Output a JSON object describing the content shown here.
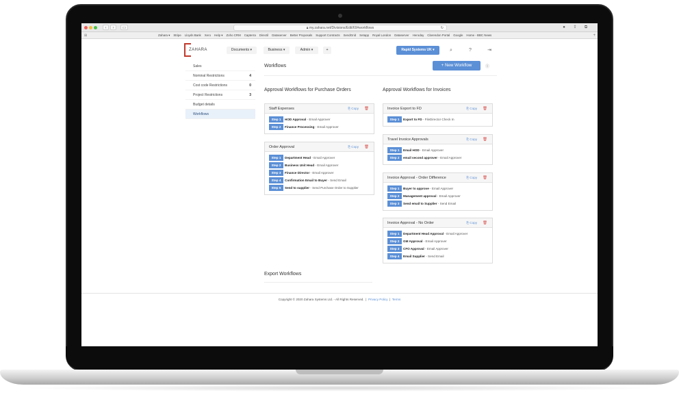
{
  "browser": {
    "url": "my.zahara.net/Divisions/Edit/69#workflows",
    "bookmarks": [
      "Zahara ▾",
      "Stripe",
      "Lloyds Bank",
      "Xero",
      "Help ▾",
      "Zoho CRM",
      "Capterra",
      "Directil",
      "Dataserver",
      "Better Proposals",
      "Support Contracts",
      "SendGrid",
      "Setapp",
      "Royal London",
      "Dataserver",
      "Heroday",
      "Clarendon Portal",
      "Google",
      "Home - BBC News"
    ]
  },
  "header": {
    "logo_text": "ZAHARA",
    "nav": [
      "Documents ▾",
      "Business ▾",
      "Admin ▾",
      "+"
    ],
    "company_button": "Rapid Systems UK ▾"
  },
  "sidebar": {
    "items": [
      {
        "label": "Sales",
        "count": ""
      },
      {
        "label": "Nominal Restrictions",
        "count": "4"
      },
      {
        "label": "Cost code Restrictions",
        "count": "0"
      },
      {
        "label": "Project Restrictions",
        "count": "3"
      },
      {
        "label": "Budget details",
        "count": ""
      },
      {
        "label": "Workflows",
        "count": ""
      }
    ]
  },
  "main": {
    "title": "Workflows",
    "new_button": "+ New Workflow",
    "po_section_title": "Approval Workflows for Purchase Orders",
    "inv_section_title": "Approval Workflows for Invoices",
    "export_section_title": "Export Workflows",
    "copy_label": "Copy",
    "po_workflows": [
      {
        "title": "Staff Expenses",
        "steps": [
          {
            "badge": "Step 1",
            "name": "HOD Approval",
            "type": "Email Approver"
          },
          {
            "badge": "Step 2",
            "name": "Finance Processing",
            "type": "Email Approver"
          }
        ]
      },
      {
        "title": "Order Approval",
        "steps": [
          {
            "badge": "Step 1",
            "name": "Department Head",
            "type": "Email Approver"
          },
          {
            "badge": "Step 2",
            "name": "Business Unit Head",
            "type": "Email Approver"
          },
          {
            "badge": "Step 3",
            "name": "Finance Director",
            "type": "Email Approver"
          },
          {
            "badge": "Step 4",
            "name": "Confirmation Email to Buyer",
            "type": "Send Email"
          },
          {
            "badge": "Step 5",
            "name": "Send to supplier",
            "type": "Send Purchase Order to Supplier"
          }
        ]
      }
    ],
    "invoice_workflows": [
      {
        "title": "Invoice Export to FD",
        "steps": [
          {
            "badge": "Step 1",
            "name": "Export to FD",
            "type": "FileDirector Check In"
          }
        ]
      },
      {
        "title": "Travel Invoice Approvals",
        "steps": [
          {
            "badge": "Step 1",
            "name": "Email HOD",
            "type": "Email Approver"
          },
          {
            "badge": "Step 2",
            "name": "email second approver",
            "type": "Email Approver"
          }
        ]
      },
      {
        "title": "Invoice Approval - Order Difference",
        "steps": [
          {
            "badge": "Step 1",
            "name": "Buyer to approve",
            "type": "Email Approver"
          },
          {
            "badge": "Step 2",
            "name": "Management approval",
            "type": "Email Approver"
          },
          {
            "badge": "Step 3",
            "name": "Send email to Supplier",
            "type": "Send Email"
          }
        ]
      },
      {
        "title": "Invoice Approval - No Order",
        "steps": [
          {
            "badge": "Step 1",
            "name": "Department Head Approval",
            "type": "Email Approver"
          },
          {
            "badge": "Step 2",
            "name": "GM Approval",
            "type": "Email Approver"
          },
          {
            "badge": "Step 3",
            "name": "CFO Approval",
            "type": "Email Approver"
          },
          {
            "badge": "Step 4",
            "name": "Email Supplier",
            "type": "Send Email"
          }
        ]
      }
    ]
  },
  "footer": {
    "copyright": "Copyright © 2020 Zahara Systems Ltd. - All Rights Reserved.",
    "privacy": "Privacy Policy",
    "terms": "Terms"
  },
  "colors": {
    "accent": "#5b8fd6",
    "danger": "#d9534f",
    "logo": "#c0392b"
  }
}
